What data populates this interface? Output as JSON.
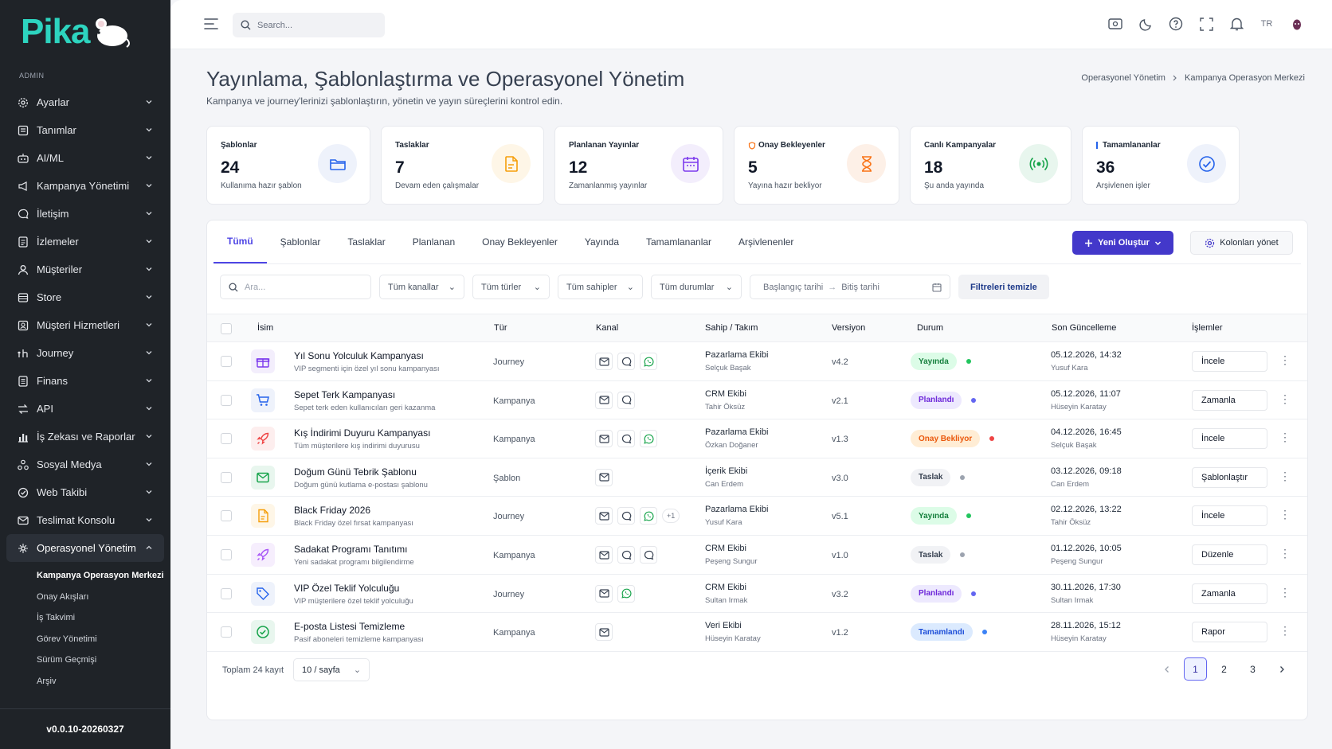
{
  "app": {
    "logo": "Pika",
    "version": "v0.0.10-20260327"
  },
  "sidebar": {
    "section": "ADMIN",
    "items": [
      {
        "label": "Ayarlar",
        "icon": "gear-icon"
      },
      {
        "label": "Tanımlar",
        "icon": "list-icon"
      },
      {
        "label": "AI/ML",
        "icon": "robot-icon"
      },
      {
        "label": "Kampanya Yönetimi",
        "icon": "megaphone-icon"
      },
      {
        "label": "İletişim",
        "icon": "chat-icon"
      },
      {
        "label": "İzlemeler",
        "icon": "doc-icon"
      },
      {
        "label": "Müşteriler",
        "icon": "user-icon"
      },
      {
        "label": "Store",
        "icon": "store-icon"
      },
      {
        "label": "Müşteri Hizmetleri",
        "icon": "support-icon"
      },
      {
        "label": "Journey",
        "icon": "journey-icon"
      },
      {
        "label": "Finans",
        "icon": "finance-icon"
      },
      {
        "label": "API",
        "icon": "api-icon"
      },
      {
        "label": "İş Zekası ve Raporlar",
        "icon": "chart-icon"
      },
      {
        "label": "Sosyal Medya",
        "icon": "social-icon"
      },
      {
        "label": "Web Takibi",
        "icon": "web-icon"
      },
      {
        "label": "Teslimat Konsolu",
        "icon": "mail-icon"
      },
      {
        "label": "Operasyonel Yönetim",
        "icon": "ops-icon"
      }
    ],
    "sub_items": [
      {
        "label": "Kampanya Operasyon Merkezi",
        "active": true
      },
      {
        "label": "Onay Akışları"
      },
      {
        "label": "İş Takvimi"
      },
      {
        "label": "Görev Yönetimi"
      },
      {
        "label": "Sürüm Geçmişi"
      },
      {
        "label": "Arşiv"
      }
    ]
  },
  "topbar": {
    "search_placeholder": "Search...",
    "lang": "TR"
  },
  "header": {
    "title": "Yayınlama, Şablonlaştırma ve Operasyonel Yönetim",
    "subtitle": "Kampanya ve journey'lerinizi şablonlaştırın, yönetin ve yayın süreçlerini kontrol edin.",
    "breadcrumb": [
      "Operasyonel Yönetim",
      "Kampanya Operasyon Merkezi"
    ]
  },
  "stats": [
    {
      "label": "Şablonlar",
      "value": "24",
      "hint": "Kullanıma hazır şablon",
      "color": "#2563eb",
      "bg": "#eef2fb"
    },
    {
      "label": "Taslaklar",
      "value": "7",
      "hint": "Devam eden çalışmalar",
      "color": "#f59e0b",
      "bg": "#fef6e7"
    },
    {
      "label": "Planlanan Yayınlar",
      "value": "12",
      "hint": "Zamanlanmış yayınlar",
      "color": "#7c3aed",
      "bg": "#f3eefc"
    },
    {
      "label": "Onay Bekleyenler",
      "value": "5",
      "hint": "Yayına hazır bekliyor",
      "color": "#f97316",
      "bg": "#fdf0e7"
    },
    {
      "label": "Canlı Kampanyalar",
      "value": "18",
      "hint": "Şu anda yayında",
      "color": "#16a34a",
      "bg": "#e8f6ee"
    },
    {
      "label": "Tamamlananlar",
      "value": "36",
      "hint": "Arşivlenen işler",
      "color": "#2563eb",
      "bg": "#eef2fb"
    }
  ],
  "tabs": [
    "Tümü",
    "Şablonlar",
    "Taslaklar",
    "Planlanan",
    "Onay Bekleyenler",
    "Yayında",
    "Tamamlananlar",
    "Arşivlenenler"
  ],
  "actions": {
    "new": "Yeni Oluştur",
    "columns": "Kolonları yönet"
  },
  "filters": {
    "search_placeholder": "Ara...",
    "channels": "Tüm kanallar",
    "types": "Tüm türler",
    "owners": "Tüm sahipler",
    "statuses": "Tüm durumlar",
    "start_date": "Başlangıç tarihi",
    "end_date": "Bitiş tarihi",
    "clear": "Filtreleri temizle"
  },
  "table": {
    "headers": [
      "İsim",
      "Tür",
      "Kanal",
      "Sahip / Takım",
      "Versiyon",
      "Durum",
      "Son Güncelleme",
      "İşlemler"
    ],
    "rows": [
      {
        "name": "Yıl Sonu Yolculuk Kampanyası",
        "desc": "VIP segmenti için özel yıl sonu kampanyası",
        "type": "Journey",
        "channels": [
          "mail",
          "chat",
          "whatsapp"
        ],
        "more": "",
        "team": "Pazarlama Ekibi",
        "owner": "Selçuk Başak",
        "version": "v4.2",
        "status": "Yayında",
        "status_color": "#15803d",
        "status_bg": "#dcfce7",
        "dot": "#22c55e",
        "date": "05.12.2026, 14:32",
        "by": "Yusuf Kara",
        "action": "İncele",
        "icon": "gift-icon",
        "icolor": "#7c3aed",
        "ibg": "#f3eefc"
      },
      {
        "name": "Sepet Terk Kampanyası",
        "desc": "Sepet terk eden kullanıcıları geri kazanma",
        "type": "Kampanya",
        "channels": [
          "mail",
          "chat"
        ],
        "more": "",
        "team": "CRM Ekibi",
        "owner": "Tahir Öksüz",
        "version": "v2.1",
        "status": "Planlandı",
        "status_color": "#6d28d9",
        "status_bg": "#ede9fe",
        "dot": "#6366f1",
        "date": "05.12.2026, 11:07",
        "by": "Hüseyin Karatay",
        "action": "Zamanla",
        "icon": "cart-icon",
        "icolor": "#2563eb",
        "ibg": "#eef2fb"
      },
      {
        "name": "Kış İndirimi Duyuru Kampanyası",
        "desc": "Tüm müşterilere kış indirimi duyurusu",
        "type": "Kampanya",
        "channels": [
          "mail",
          "chat",
          "whatsapp"
        ],
        "more": "",
        "team": "Pazarlama Ekibi",
        "owner": "Özkan Doğaner",
        "version": "v1.3",
        "status": "Onay Bekliyor",
        "status_color": "#ea580c",
        "status_bg": "#ffedd5",
        "dot": "#ef4444",
        "date": "04.12.2026, 16:45",
        "by": "Selçuk Başak",
        "action": "İncele",
        "icon": "rocket-icon",
        "icolor": "#ef4444",
        "ibg": "#fdeeee"
      },
      {
        "name": "Doğum Günü Tebrik Şablonu",
        "desc": "Doğum günü kutlama e-postası şablonu",
        "type": "Şablon",
        "channels": [
          "mail"
        ],
        "more": "",
        "team": "İçerik Ekibi",
        "owner": "Can Erdem",
        "version": "v3.0",
        "status": "Taslak",
        "status_color": "#374151",
        "status_bg": "#f1f2f5",
        "dot": "#9ca3af",
        "date": "03.12.2026, 09:18",
        "by": "Can Erdem",
        "action": "Şablonlaştır",
        "icon": "envelope-icon",
        "icolor": "#16a34a",
        "ibg": "#e8f6ee"
      },
      {
        "name": "Black Friday 2026",
        "desc": "Black Friday özel fırsat kampanyası",
        "type": "Journey",
        "channels": [
          "mail",
          "chat",
          "whatsapp"
        ],
        "more": "+1",
        "team": "Pazarlama Ekibi",
        "owner": "Yusuf Kara",
        "version": "v5.1",
        "status": "Yayında",
        "status_color": "#15803d",
        "status_bg": "#dcfce7",
        "dot": "#22c55e",
        "date": "02.12.2026, 13:22",
        "by": "Tahir Öksüz",
        "action": "İncele",
        "icon": "file-icon",
        "icolor": "#f59e0b",
        "ibg": "#fef6e7"
      },
      {
        "name": "Sadakat Programı Tanıtımı",
        "desc": "Yeni sadakat programı bilgilendirme",
        "type": "Kampanya",
        "channels": [
          "mail",
          "chat",
          "chat"
        ],
        "more": "",
        "team": "CRM Ekibi",
        "owner": "Peşeng Sungur",
        "version": "v1.0",
        "status": "Taslak",
        "status_color": "#374151",
        "status_bg": "#f1f2f5",
        "dot": "#9ca3af",
        "date": "01.12.2026, 10:05",
        "by": "Peşeng Sungur",
        "action": "Düzenle",
        "icon": "rocket-icon",
        "icolor": "#a855f7",
        "ibg": "#f6eefd"
      },
      {
        "name": "VIP Özel Teklif Yolculuğu",
        "desc": "VIP müşterilere özel teklif yolculuğu",
        "type": "Journey",
        "channels": [
          "mail",
          "whatsapp"
        ],
        "more": "",
        "team": "CRM Ekibi",
        "owner": "Sultan Irmak",
        "version": "v3.2",
        "status": "Planlandı",
        "status_color": "#6d28d9",
        "status_bg": "#ede9fe",
        "dot": "#6366f1",
        "date": "30.11.2026, 17:30",
        "by": "Sultan Irmak",
        "action": "Zamanla",
        "icon": "tag-icon",
        "icolor": "#2563eb",
        "ibg": "#eef2fb"
      },
      {
        "name": "E-posta Listesi Temizleme",
        "desc": "Pasif aboneleri temizleme kampanyası",
        "type": "Kampanya",
        "channels": [
          "mail"
        ],
        "more": "",
        "team": "Veri Ekibi",
        "owner": "Hüseyin Karatay",
        "version": "v1.2",
        "status": "Tamamlandı",
        "status_color": "#1d4ed8",
        "status_bg": "#dbeafe",
        "dot": "#3b82f6",
        "date": "28.11.2026, 15:12",
        "by": "Hüseyin Karatay",
        "action": "Rapor",
        "icon": "check-circle-icon",
        "icolor": "#16a34a",
        "ibg": "#e8f6ee"
      }
    ]
  },
  "footer": {
    "total": "Toplam 24 kayıt",
    "per_page": "10 / sayfa",
    "pages": [
      "1",
      "2",
      "3"
    ]
  }
}
